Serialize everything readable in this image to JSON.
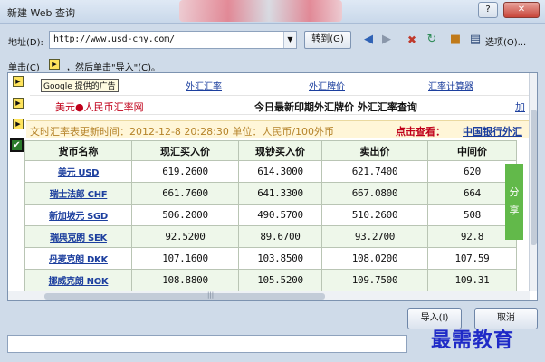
{
  "window": {
    "title": "新建 Web 查询",
    "help_button": "?",
    "close_button": "✕"
  },
  "address": {
    "label": "地址(D):",
    "url": "http://www.usd-cny.com/",
    "go_button": "转到(G)",
    "options_label": "选项(O)..."
  },
  "instructions": {
    "prefix": "单击(C)",
    "suffix": "，然后单击\"导入\"(C)。"
  },
  "page": {
    "nav": {
      "google_ad": "Google 提供的广告",
      "links": [
        "外汇汇率",
        "外汇牌价",
        "汇率计算器"
      ]
    },
    "site_logo": "美元●人民币汇率网",
    "site_title": "今日最新印期外汇牌价 外汇汇率查询",
    "site_more": "加",
    "update_text": "文时汇率表更新时间：2012-12-8 20:28:30  单位：人民币/100外币",
    "update_click": "点击查看：",
    "update_link": "中国银行外汇",
    "share_label": "分享",
    "table": {
      "headers": [
        "货币名称",
        "现汇买入价",
        "现钞买入价",
        "卖出价",
        "中间价"
      ],
      "rows": [
        {
          "currency": "美元 USD",
          "spot_buy": "619.2600",
          "cash_buy": "614.3000",
          "sell": "621.7400",
          "mid": "620"
        },
        {
          "currency": "瑞士法郎 CHF",
          "spot_buy": "661.7600",
          "cash_buy": "641.3300",
          "sell": "667.0800",
          "mid": "664"
        },
        {
          "currency": "新加坡元 SGD",
          "spot_buy": "506.2000",
          "cash_buy": "490.5700",
          "sell": "510.2600",
          "mid": "508"
        },
        {
          "currency": "瑞典克朗 SEK",
          "spot_buy": "92.5200",
          "cash_buy": "89.6700",
          "sell": "93.2700",
          "mid": "92.8"
        },
        {
          "currency": "丹麦克朗 DKK",
          "spot_buy": "107.1600",
          "cash_buy": "103.8500",
          "sell": "108.0200",
          "mid": "107.59"
        },
        {
          "currency": "挪威克朗 NOK",
          "spot_buy": "108.8800",
          "cash_buy": "105.5200",
          "sell": "109.7500",
          "mid": "109.31"
        }
      ]
    }
  },
  "buttons": {
    "import": "导入(I)",
    "cancel": "取消"
  },
  "watermark": "最需教育"
}
